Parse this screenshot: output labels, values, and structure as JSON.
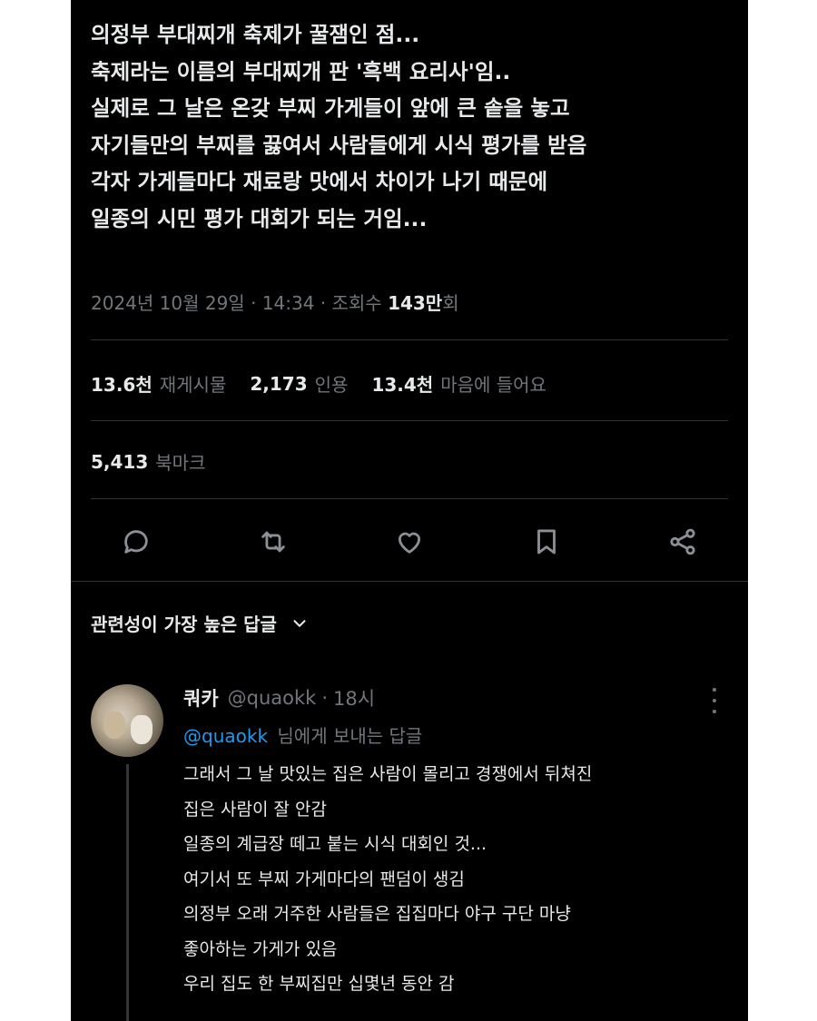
{
  "tweet": {
    "lines": [
      "의정부 부대찌개 축제가 꿀잼인 점...",
      "축제라는 이름의 부대찌개 판 '흑백 요리사'임..",
      "실제로 그 날은 온갖 부찌 가게들이 앞에 큰 솥을 놓고",
      "자기들만의 부찌를 끓여서 사람들에게 시식 평가를 받음",
      "각자 가게들마다 재료랑 맛에서 차이가 나기 때문에",
      "일종의 시민 평가 대회가 되는 거임..."
    ],
    "meta": {
      "timestamp": "2024년 10월 29일 · 14:34 · ",
      "views_label": "조회수",
      "views_count": "143만",
      "views_suffix": "회"
    },
    "stats": {
      "retweets_count": "13.6천",
      "retweets_label": "재게시물",
      "quotes_count": "2,173",
      "quotes_label": "인용",
      "likes_count": "13.4천",
      "likes_label": "마음에 들어요",
      "bookmarks_count": "5,413",
      "bookmarks_label": "북마크"
    },
    "actions": [
      "reply-icon",
      "retweet-icon",
      "heart-icon",
      "bookmark-icon",
      "share-icon"
    ]
  },
  "replies_sort": {
    "label": "관련성이 가장 높은 답글"
  },
  "reply": {
    "name": "쿼카",
    "handle": "@quaokk",
    "time": "18시",
    "replying_mention": "@quaokk",
    "replying_text": "님에게 보내는 답글",
    "lines": [
      "그래서 그 날 맛있는 집은 사람이 몰리고 경쟁에서 뒤쳐진",
      "집은 사람이 잘 안감",
      "일종의 계급장 떼고 붙는 시식 대회인 것...",
      "여기서 또 부찌 가게마다의 팬덤이 생김",
      "의정부 오래 거주한 사람들은 집집마다 야구 구단 마냥",
      "좋아하는 가게가 있음",
      "우리 집도 한 부찌집만 십몇년 동안 감"
    ]
  },
  "colors": {
    "background": "#000000",
    "text_primary": "#e7e9ea",
    "text_secondary": "#71767b",
    "link": "#1d9bf0",
    "divider": "#2f3336"
  }
}
